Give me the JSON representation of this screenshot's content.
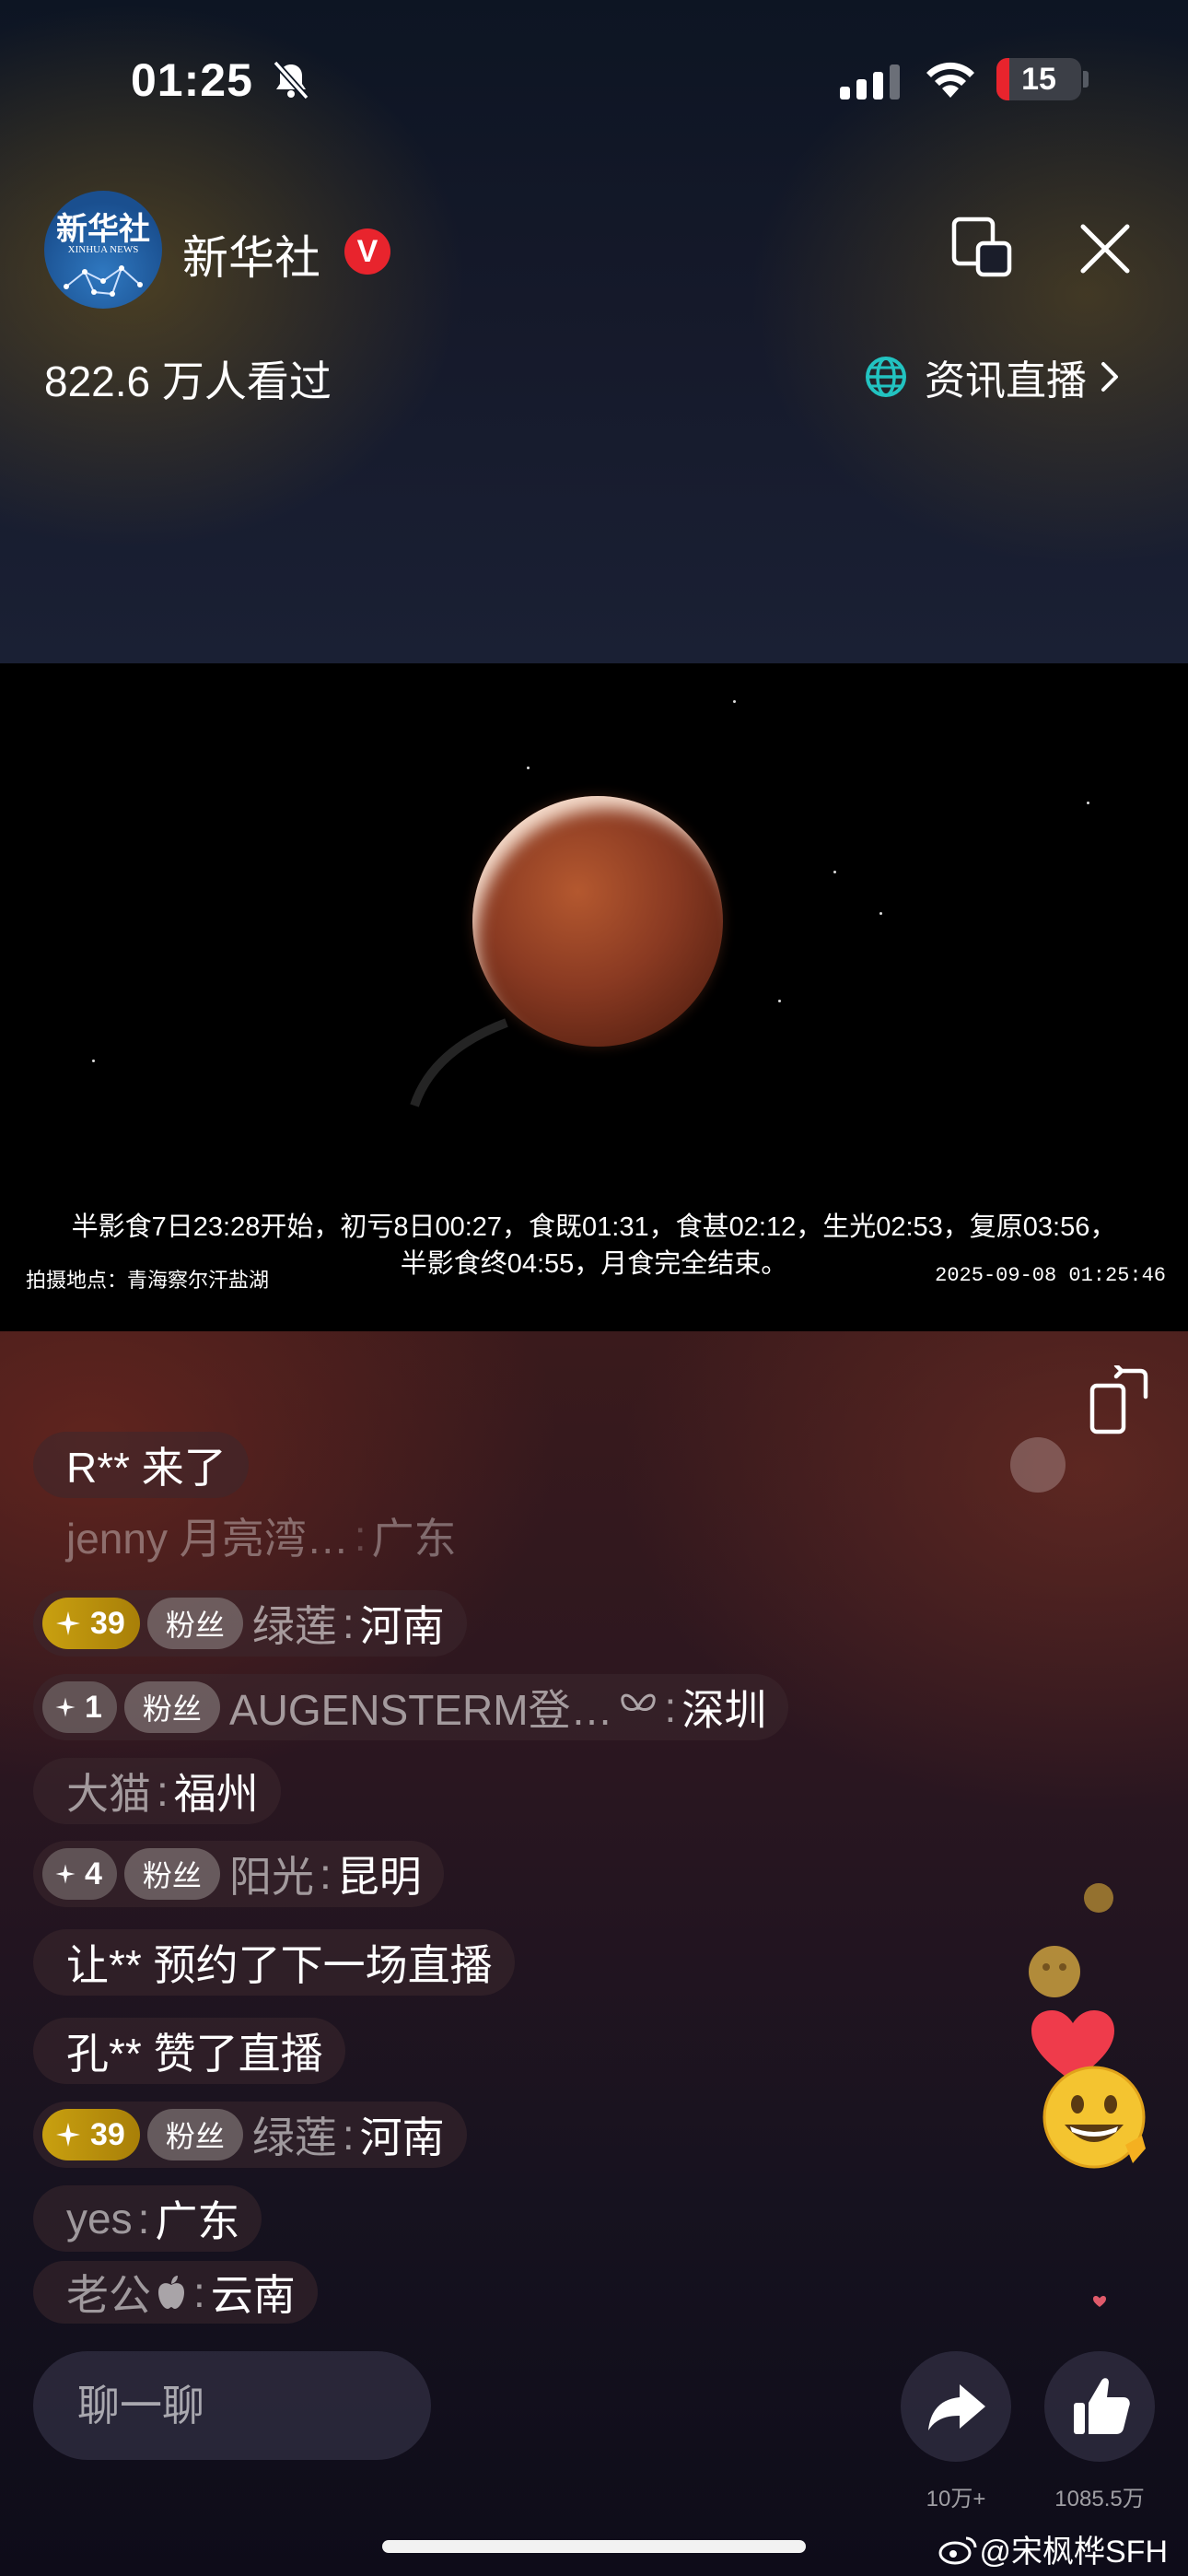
{
  "status_bar": {
    "time": "01:25",
    "battery": "15",
    "battery_level": 0.15
  },
  "header": {
    "avatar_title": "新华社",
    "avatar_subtitle": "XINHUA NEWS",
    "channel_name": "新华社",
    "verified_badge": "V",
    "viewers": "822.6 万人看过",
    "category": "资讯直播"
  },
  "video": {
    "caption_line1": "半影食7日23:28开始，初亏8日00:27，食既01:31，食甚02:12，生光02:53，复原03:56，",
    "caption_line2": "半影食终04:55，月食完全结束。",
    "location": "拍摄地点：青海察尔汗盐湖",
    "timestamp": "2025-09-08 01:25:46"
  },
  "chat": {
    "messages": [
      {
        "text": "R** 来了"
      },
      {
        "user": "jenny 月亮湾…",
        "location": "广东"
      },
      {
        "level": "39",
        "fan": "粉丝",
        "user": "绿莲",
        "location": "河南"
      },
      {
        "level": "1",
        "fan": "粉丝",
        "user": "AUGENSTERM登…",
        "location": "深圳"
      },
      {
        "user": "大猫",
        "location": "福州"
      },
      {
        "level": "4",
        "fan": "粉丝",
        "user": "阳光",
        "location": "昆明"
      },
      {
        "text": "让** 预约了下一场直播"
      },
      {
        "text": "孔** 赞了直播"
      },
      {
        "level": "39",
        "fan": "粉丝",
        "user": "绿莲",
        "location": "河南"
      },
      {
        "user": "yes",
        "location": "广东"
      },
      {
        "user": "老公",
        "location": "云南"
      }
    ]
  },
  "bottom_bar": {
    "chat_placeholder": "聊一聊",
    "share_count": "10万+",
    "like_count": "1085.5万"
  },
  "watermark": "@宋枫桦SFH"
}
